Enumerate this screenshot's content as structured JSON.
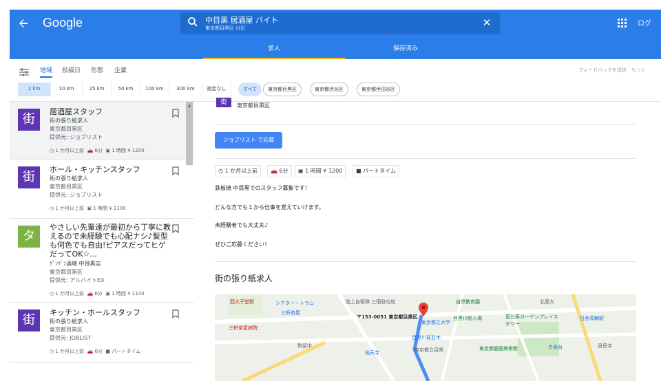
{
  "header": {
    "brand": "Google",
    "search_query": "中目黒 居酒屋 バイト",
    "search_location": "東京都目黒区 付近",
    "login_label": "ログ",
    "tabs": [
      {
        "label": "求人",
        "active": true
      },
      {
        "label": "保存済み",
        "active": false
      }
    ],
    "colors": {
      "bar": "#2b7de9",
      "accent": "#fbbc04"
    }
  },
  "filters": {
    "tabs": [
      "地域",
      "投稿日",
      "形態",
      "企業"
    ],
    "active_tab": "地域",
    "feedback": "フィードバックを送信",
    "more": "もっと",
    "distances": [
      "2 km",
      "10 km",
      "25 km",
      "50 km",
      "100 km",
      "300 km",
      "指定なし"
    ],
    "active_distance": "2 km",
    "areas": [
      "すべて",
      "東京都目黒区",
      "東京都渋谷区",
      "東京都世田谷区"
    ],
    "active_area": "すべて"
  },
  "jobs": [
    {
      "logo": "街",
      "logo_color": "#5e35b1",
      "title": "居酒屋スタッフ",
      "company": "街の張り紙求人",
      "location": "東京都目黒区",
      "via": "提供元: ジョブリスト",
      "posted": "1 か月以上前",
      "distance": "6分",
      "salary": "1 時間 ¥ 1200",
      "selected": true
    },
    {
      "logo": "街",
      "logo_color": "#5e35b1",
      "title": "ホール・キッチンスタッフ",
      "company": "街の張り紙求人",
      "location": "東京都目黒区",
      "via": "提供元: ジョブリスト",
      "posted": "1 か月以上前",
      "salary": "1 時間 ¥ 1100"
    },
    {
      "logo": "タ",
      "logo_color": "#7cb342",
      "title": "やさしい先輩達が最初から丁寧に教えるので未経験でも心配ナシ♪髪型も何色でも自由!ピアスだってヒゲだってOK☆...",
      "company": "ｹﾞﾝｹﾞﾝ酒場 中目黒店",
      "location": "東京都目黒区",
      "via": "提供元: アルバイトEX",
      "posted": "1 か月以上前",
      "distance": "6分",
      "salary": "1 時間 ¥ 1100"
    },
    {
      "logo": "街",
      "logo_color": "#5e35b1",
      "title": "キッチン・ホールスタッフ",
      "company": "街の張り紙求人",
      "location": "東京都目黒区",
      "via": "提供元: JOBLIST",
      "posted": "1 か月以上前",
      "distance": "6分",
      "type": "パートタイム"
    }
  ],
  "detail": {
    "logo": "街",
    "location": "東京都目黒区",
    "apply_label": "ジョブリスト で応募",
    "posted": "1 か月以上前",
    "distance": "6分",
    "salary": "1 時間 ¥ 1200",
    "type": "パートタイム",
    "paragraphs": [
      "鉄板焼 中目黒でのスタッフ募集です！",
      "どんな方でも１から仕事を覚えていけます。",
      "未経験者でも大丈夫♪",
      "ぜひご応募ください！"
    ],
    "section_title": "街の張り紙求人",
    "map": {
      "marker_label": "〒153-0051 東京都目黒区",
      "labels": [
        "西大子堂駅",
        "シアター・トラム",
        "三軒茶屋",
        "三軒茶屋病院",
        "駒留中",
        "陸上自衛隊 三宿駐屯地",
        "東京都立大学",
        "目黒川桜並木",
        "目黒川船入場",
        "祐天寺",
        "東京都立目黒",
        "恵比寿ガーデンプレイスタワー",
        "北里大",
        "白金高輪駅",
        "自然教育園",
        "東京都庭園美術館",
        "白金台",
        "泉岳寺"
      ]
    }
  }
}
